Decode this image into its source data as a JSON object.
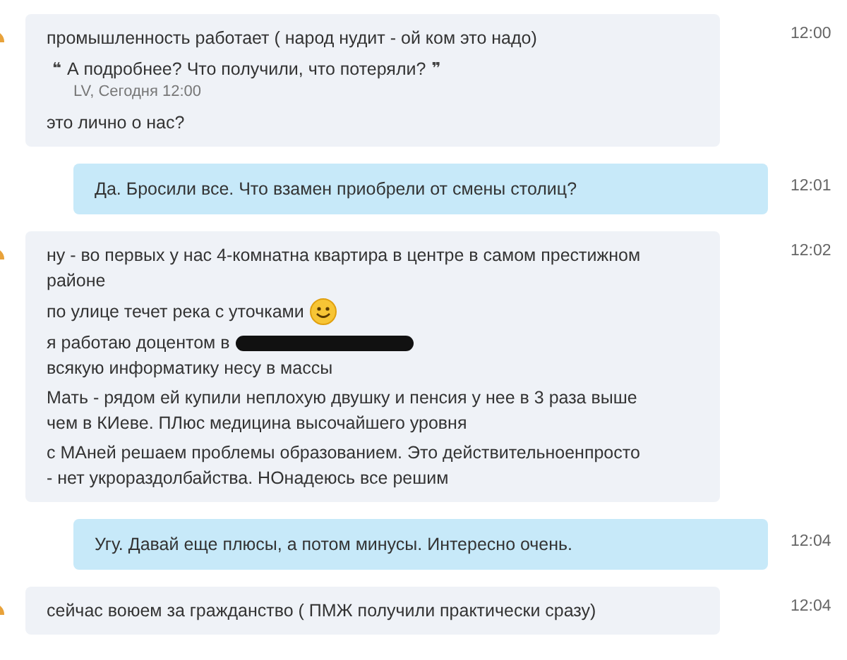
{
  "messages": [
    {
      "kind": "incoming",
      "time": "12:00",
      "blocks": [
        {
          "kind": "text",
          "parts": [
            {
              "kind": "text",
              "text": "промышленность работает ( народ нудит - ой ком это надо)"
            }
          ]
        },
        {
          "kind": "quote",
          "open_mark": "❝",
          "text": "А подробнее? Что получили, что потеряли?",
          "close_mark": "❞",
          "author": "LV, Сегодня 12:00"
        },
        {
          "kind": "text",
          "parts": [
            {
              "kind": "text",
              "text": "это лично о нас?"
            }
          ]
        }
      ]
    },
    {
      "kind": "outgoing",
      "time": "12:01",
      "blocks": [
        {
          "kind": "text",
          "parts": [
            {
              "kind": "text",
              "text": "Да. Бросили все. Что взамен приобрели от смены столиц?"
            }
          ]
        }
      ]
    },
    {
      "kind": "incoming",
      "time": "12:02",
      "blocks": [
        {
          "kind": "text",
          "parts": [
            {
              "kind": "text",
              "text": "ну - во первых у нас 4-комнатна квартира в центре в самом престижном районе"
            }
          ]
        },
        {
          "kind": "text",
          "parts": [
            {
              "kind": "text",
              "text": "по улице течет река с уточками"
            },
            {
              "kind": "emoji"
            }
          ]
        },
        {
          "kind": "text",
          "parts": [
            {
              "kind": "text",
              "text": "я работаю доцентом в"
            },
            {
              "kind": "redacted"
            },
            {
              "kind": "text",
              "text": "всякую информатику несу в массы"
            }
          ]
        },
        {
          "kind": "text",
          "parts": [
            {
              "kind": "text",
              "text": "Мать - рядом ей купили неплохую двушку и пенсия у нее в 3 раза выше чем в КИеве. ПЛюс медицина высочайшего уровня"
            }
          ]
        },
        {
          "kind": "text",
          "parts": [
            {
              "kind": "text",
              "text": "с МАней решаем проблемы образованием. Это действительноенпросто - нет укрораздолбайства. НОнадеюсь все решим"
            }
          ]
        }
      ]
    },
    {
      "kind": "outgoing",
      "time": "12:04",
      "blocks": [
        {
          "kind": "text",
          "parts": [
            {
              "kind": "text",
              "text": "Угу. Давай еще плюсы, а потом минусы. Интересно очень."
            }
          ]
        }
      ]
    },
    {
      "kind": "incoming",
      "time": "12:04",
      "blocks": [
        {
          "kind": "text",
          "parts": [
            {
              "kind": "text",
              "text": "сейчас воюем за гражданство ( ПМЖ получили практически сразу)"
            }
          ]
        }
      ]
    }
  ]
}
